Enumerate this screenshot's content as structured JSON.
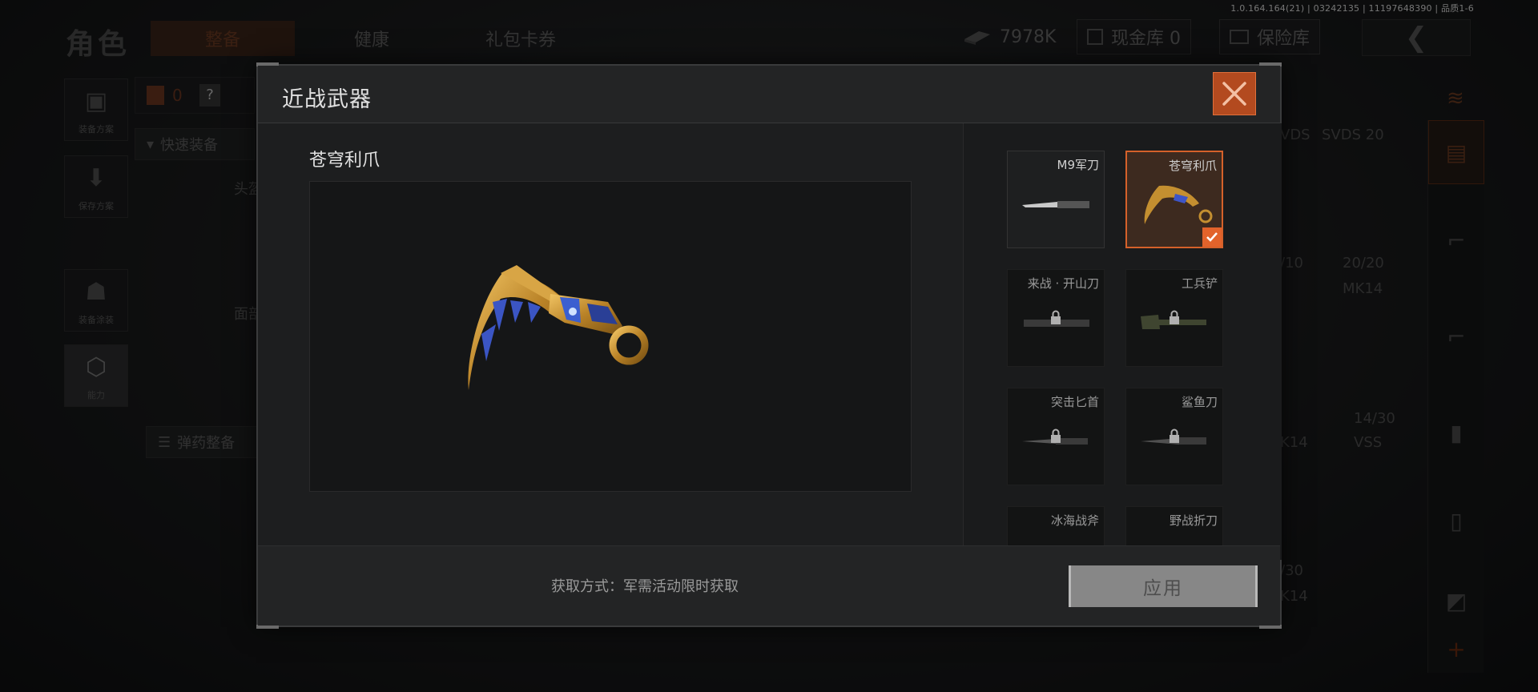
{
  "version": "1.0.164.164(21) | 03242135 | 11197648390 | 品质1-6",
  "background": {
    "title": "角色",
    "tabs": [
      "整备",
      "健康",
      "礼包卡券"
    ],
    "currency": "7978K",
    "cash_vault": "现金库 0",
    "safe_box": "保险库",
    "armor_count": "0",
    "help": "?",
    "left_buttons": [
      "装备方案",
      "保存方案",
      "装备涂装",
      "能力"
    ],
    "quick_equip": "快速装备",
    "head_label": "头盔",
    "face_label": "面部",
    "ammo_equip": "弹药整备",
    "right_stats": [
      "VDS",
      "SVDS 20",
      "/10",
      "20/20",
      "MK14",
      "14/30",
      "K14",
      "VSS",
      "/30",
      "K14"
    ]
  },
  "dialog": {
    "title": "近战武器",
    "selected_name": "苍穹利爪",
    "weapons": [
      {
        "name": "M9军刀",
        "locked": false,
        "selected": false
      },
      {
        "name": "苍穹利爪",
        "locked": false,
        "selected": true
      },
      {
        "name": "来战 · 开山刀",
        "locked": true,
        "selected": false
      },
      {
        "name": "工兵铲",
        "locked": true,
        "selected": false
      },
      {
        "name": "突击匕首",
        "locked": true,
        "selected": false
      },
      {
        "name": "鲨鱼刀",
        "locked": true,
        "selected": false
      },
      {
        "name": "冰海战斧",
        "locked": true,
        "selected": false
      },
      {
        "name": "野战折刀",
        "locked": true,
        "selected": false
      }
    ],
    "acquire_text": "获取方式：军需活动限时获取",
    "apply_label": "应用"
  },
  "colors": {
    "accent": "#e2632b",
    "close_bg": "#b34a1f",
    "blade_gold": "#c8922e",
    "blade_blue": "#3d55c8"
  }
}
